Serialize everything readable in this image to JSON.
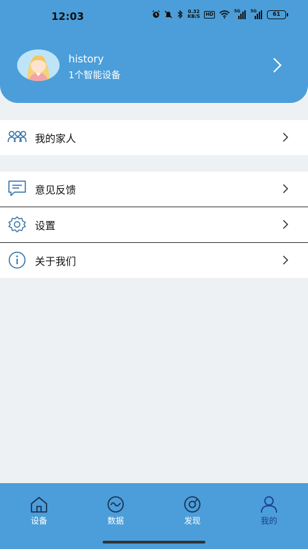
{
  "status_bar": {
    "time": "12:03",
    "net_speed_value": "0.32",
    "net_speed_unit": "KB/S",
    "hd_badge": "HD",
    "signal1": "5G",
    "signal2": "5G",
    "battery": "61"
  },
  "profile": {
    "username": "history",
    "device_count": "1个智能设备"
  },
  "menu": {
    "family": "我的家人",
    "feedback": "意见反馈",
    "settings": "设置",
    "about": "关于我们"
  },
  "tabs": [
    {
      "label": "设备",
      "icon": "home-icon",
      "active": false
    },
    {
      "label": "数据",
      "icon": "chart-icon",
      "active": false
    },
    {
      "label": "发现",
      "icon": "discover-icon",
      "active": false
    },
    {
      "label": "我的",
      "icon": "profile-icon",
      "active": true
    }
  ],
  "colors": {
    "header": "#4b9ed9",
    "background": "#eef1f4",
    "active_tab": "#1f3d8f",
    "icon_outline": "#2e6fa6"
  }
}
